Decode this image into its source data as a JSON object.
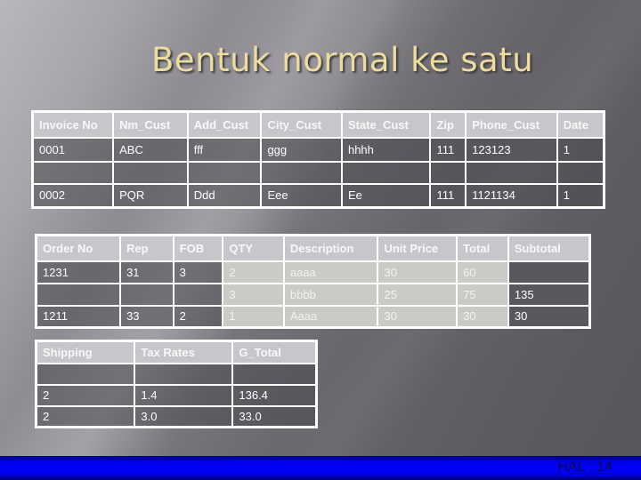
{
  "slide": {
    "title": "Bentuk normal ke satu",
    "footer_label": "HAL : 14",
    "colors": {
      "title": "#ecdca0",
      "footer_bar": "#0000ff",
      "header_cell": "#c7c6ca",
      "highlight_cell": "#c9cbc6"
    }
  },
  "invoice_table": {
    "headers": [
      "Invoice No",
      "Nm_Cust",
      "Add_Cust",
      "City_Cust",
      "State_Cust",
      "Zip",
      "Phone_Cust",
      "Date"
    ],
    "rows": [
      [
        "0001",
        "ABC",
        "fff",
        "ggg",
        "hhhh",
        "111",
        "123123",
        "1"
      ],
      [
        "",
        "",
        "",
        "",
        "",
        "",
        "",
        ""
      ],
      [
        "0002",
        "PQR",
        "Ddd",
        "Eee",
        "Ee",
        "111",
        "1121134",
        "1"
      ]
    ]
  },
  "order_table": {
    "headers": [
      "Order No",
      "Rep",
      "FOB",
      "QTY",
      "Description",
      "Unit Price",
      "Total",
      "Subtotal"
    ],
    "rows": [
      [
        "1231",
        "31",
        "3",
        "2",
        "aaaa",
        "30",
        "60",
        ""
      ],
      [
        "",
        "",
        "",
        "3",
        "bbbb",
        "25",
        "75",
        "135"
      ],
      [
        "1211",
        "33",
        "2",
        "1",
        "Aaaa",
        "30",
        "30",
        "30"
      ]
    ]
  },
  "total_table": {
    "headers": [
      "Shipping",
      "Tax Rates",
      "G_Total"
    ],
    "rows": [
      [
        "",
        "",
        ""
      ],
      [
        "2",
        "1.4",
        "136.4"
      ],
      [
        "2",
        "3.0",
        "33.0"
      ]
    ]
  }
}
